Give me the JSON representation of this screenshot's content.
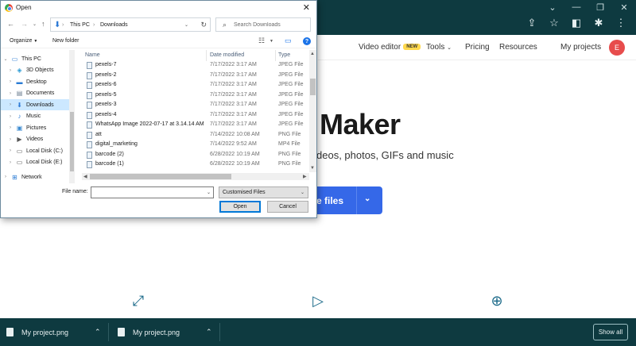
{
  "window_controls": [
    "⌄",
    "—",
    "❐",
    "✕"
  ],
  "browser_icons": [
    "share-icon",
    "star-icon",
    "sidebar-icon",
    "puzzle-icon",
    "menu-icon"
  ],
  "site": {
    "nav": {
      "video_editor": "Video editor",
      "new_badge": "NEW",
      "tools": "Tools",
      "pricing": "Pricing",
      "resources": "Resources",
      "my_projects": "My projects",
      "avatar_letter": "E"
    },
    "hero_title_visible": "Maker",
    "hero_sub_visible": "deos, photos, GIFs and music",
    "cta_visible": "e files",
    "accent_color": "#3568e8"
  },
  "dialog": {
    "title": "Open",
    "breadcrumb": [
      "This PC",
      "Downloads"
    ],
    "search_placeholder": "Search Downloads",
    "organize": "Organize",
    "new_folder": "New folder",
    "help": "?",
    "tree": [
      {
        "label": "This PC",
        "icon": "pc-icon",
        "glyph": "🖥",
        "expanded": true
      },
      {
        "label": "3D Objects",
        "icon": "cube-icon",
        "glyph": "◈"
      },
      {
        "label": "Desktop",
        "icon": "desktop-icon",
        "glyph": "▬"
      },
      {
        "label": "Documents",
        "icon": "documents-icon",
        "glyph": "▤"
      },
      {
        "label": "Downloads",
        "icon": "downloads-icon",
        "glyph": "⬇",
        "selected": true
      },
      {
        "label": "Music",
        "icon": "music-icon",
        "glyph": "♪"
      },
      {
        "label": "Pictures",
        "icon": "pictures-icon",
        "glyph": "▣"
      },
      {
        "label": "Videos",
        "icon": "videos-icon",
        "glyph": "▶"
      },
      {
        "label": "Local Disk (C:)",
        "icon": "disk-icon",
        "glyph": "▭"
      },
      {
        "label": "Local Disk (E:)",
        "icon": "disk-icon",
        "glyph": "▭"
      },
      {
        "label": "Network",
        "icon": "network-icon",
        "glyph": "⊞"
      }
    ],
    "columns": {
      "name": "Name",
      "date": "Date modified",
      "type": "Type"
    },
    "files": [
      {
        "name": "pexels-7",
        "date": "7/17/2022 3:17 AM",
        "type": "JPEG File"
      },
      {
        "name": "pexels-2",
        "date": "7/17/2022 3:17 AM",
        "type": "JPEG File"
      },
      {
        "name": "pexels-6",
        "date": "7/17/2022 3:17 AM",
        "type": "JPEG File"
      },
      {
        "name": "pexels-5",
        "date": "7/17/2022 3:17 AM",
        "type": "JPEG File"
      },
      {
        "name": "pexels-3",
        "date": "7/17/2022 3:17 AM",
        "type": "JPEG File"
      },
      {
        "name": "pexels-4",
        "date": "7/17/2022 3:17 AM",
        "type": "JPEG File"
      },
      {
        "name": "WhatsApp Image 2022-07-17 at 3.14.14 AM",
        "date": "7/17/2022 3:17 AM",
        "type": "JPEG File"
      },
      {
        "name": "att",
        "date": "7/14/2022 10:08 AM",
        "type": "PNG File"
      },
      {
        "name": "digital_marketing",
        "date": "7/14/2022 9:52 AM",
        "type": "MP4 File"
      },
      {
        "name": "barcode (2)",
        "date": "6/28/2022 10:19 AM",
        "type": "PNG File"
      },
      {
        "name": "barcode (1)",
        "date": "6/28/2022 10:19 AM",
        "type": "PNG File"
      }
    ],
    "file_name_label": "File name:",
    "file_name_value": "",
    "filter_value": "Customised Files",
    "open_button": "Open",
    "cancel_button": "Cancel"
  },
  "downloads_bar": {
    "items": [
      {
        "name": "My project.png"
      },
      {
        "name": "My project.png"
      }
    ],
    "show_all": "Show all"
  }
}
